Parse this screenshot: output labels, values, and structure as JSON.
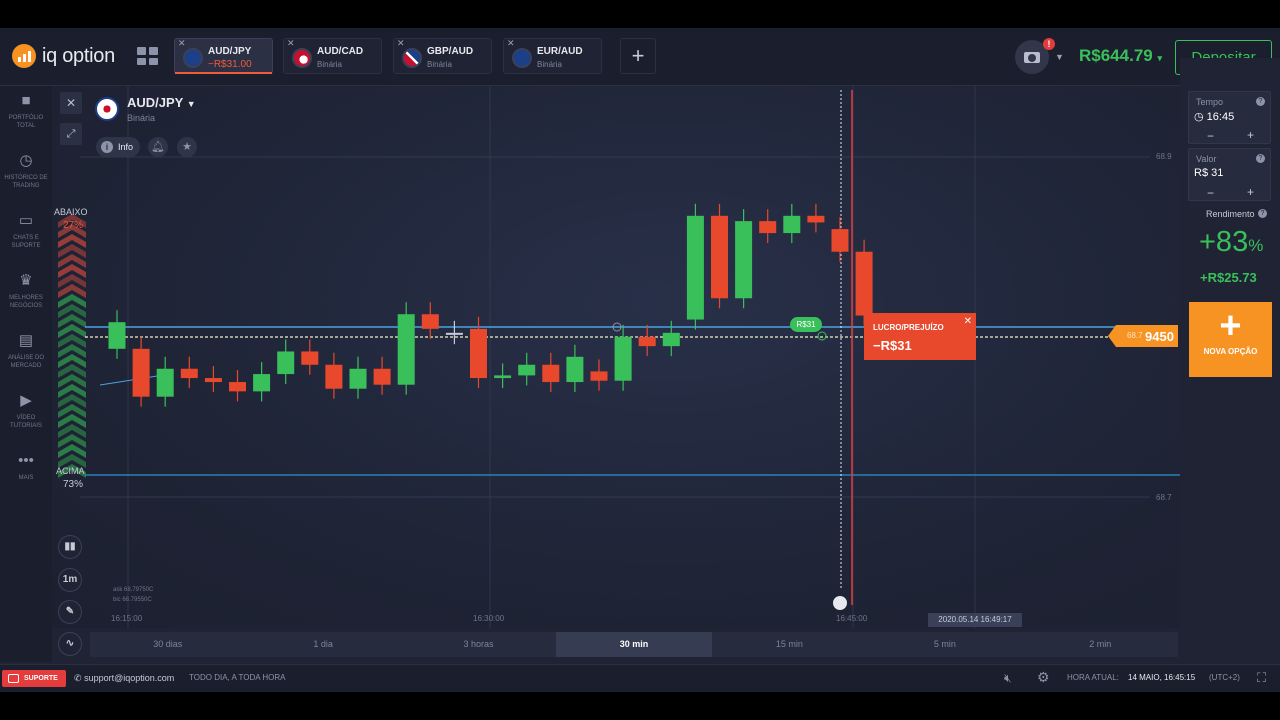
{
  "app": {
    "logo_text": "iq option"
  },
  "tabs": [
    {
      "name": "AUD/JPY",
      "sub": "−R$31.00",
      "active": true
    },
    {
      "name": "AUD/CAD",
      "sub": "Binária"
    },
    {
      "name": "GBP/AUD",
      "sub": "Binária"
    },
    {
      "name": "EUR/AUD",
      "sub": "Binária"
    }
  ],
  "header": {
    "notification_badge": "!",
    "balance": "R$644.79",
    "deposit_label": "Depositar"
  },
  "sidebar": [
    {
      "icon": "briefcase-icon",
      "label": "PORTFÓLIO TOTAL"
    },
    {
      "icon": "history-icon",
      "label": "HISTÓRICO DE TRADING"
    },
    {
      "icon": "chat-icon",
      "label": "CHATS E SUPORTE"
    },
    {
      "icon": "trophy-icon",
      "label": "MELHORES NEGÓCIOS"
    },
    {
      "icon": "analysis-icon",
      "label": "ANÁLISE DO MERCADO"
    },
    {
      "icon": "play-icon",
      "label": "VÍDEO TUTORIAIS"
    },
    {
      "icon": "more-icon",
      "label": "MAIS"
    }
  ],
  "asset": {
    "title": "AUD/JPY",
    "subtitle": "Binária",
    "info_label": "Info"
  },
  "sentiment": {
    "down_label": "ABAIXO",
    "down_pct": "27%",
    "up_label": "ACIMA",
    "up_pct": "73%"
  },
  "trade": {
    "tag": "R$31",
    "profit_label": "LUCRO/PREJUÍZO",
    "profit_value": "−R$31",
    "price_dim": "68.7",
    "price_main": "9450"
  },
  "axis": {
    "y_top": "68.9",
    "y_bottom": "68.7",
    "x_ticks": [
      "16:15:00",
      "16:30:00",
      "16:45:00"
    ],
    "current_time": "2020.05.14 16:49:17",
    "ask": "ask 68.79750C",
    "bid": "bic 68.79550C"
  },
  "tools": {
    "timeframe": "1m"
  },
  "timeframes": [
    {
      "label": "30 dias"
    },
    {
      "label": "1 dia"
    },
    {
      "label": "3 horas"
    },
    {
      "label": "30 min",
      "active": true
    },
    {
      "label": "15 min"
    },
    {
      "label": "5 min"
    },
    {
      "label": "2 min"
    }
  ],
  "right_panel": {
    "time_label": "Tempo",
    "time_value": "16:45",
    "amount_label": "Valor",
    "amount_value": "R$ 31",
    "yield_label": "Rendimento",
    "yield_pct": "+83",
    "yield_value": "+R$25.73",
    "new_option_label": "NOVA OPÇÃO"
  },
  "footer": {
    "support_label": "SUPORTE",
    "email": "support@iqoption.com",
    "hours": "TODO DIA, A TODA HORA",
    "time_label": "HORA ATUAL:",
    "time_value": "14 MAIO, 16:45:15",
    "timezone": "(UTC+2)"
  },
  "chart_data": {
    "type": "candlestick",
    "y_axis_labels": [
      "68.9",
      "68.7"
    ],
    "x_axis_labels": [
      "16:15:00",
      "16:30:00",
      "16:45:00"
    ],
    "candles": [
      {
        "dir": "up",
        "o": 14.0,
        "c": 16.0
      },
      {
        "dir": "down",
        "o": 14.0,
        "c": 10.4
      },
      {
        "dir": "up",
        "o": 10.4,
        "c": 12.5
      },
      {
        "dir": "down",
        "o": 12.5,
        "c": 11.8
      },
      {
        "dir": "down",
        "o": 11.8,
        "c": 11.5
      },
      {
        "dir": "down",
        "o": 11.5,
        "c": 10.8
      },
      {
        "dir": "up",
        "o": 10.8,
        "c": 12.1
      },
      {
        "dir": "up",
        "o": 12.1,
        "c": 13.8
      },
      {
        "dir": "down",
        "o": 13.8,
        "c": 12.8
      },
      {
        "dir": "down",
        "o": 12.8,
        "c": 11.0
      },
      {
        "dir": "up",
        "o": 11.0,
        "c": 12.5
      },
      {
        "dir": "down",
        "o": 12.5,
        "c": 11.3
      },
      {
        "dir": "up",
        "o": 11.3,
        "c": 16.6
      },
      {
        "dir": "down",
        "o": 16.6,
        "c": 15.5
      },
      {
        "dir": "flat",
        "o": 15.2,
        "c": 15.1
      },
      {
        "dir": "down",
        "o": 15.5,
        "c": 11.8
      },
      {
        "dir": "up",
        "o": 11.8,
        "c": 12.0
      },
      {
        "dir": "up",
        "o": 12.0,
        "c": 12.8
      },
      {
        "dir": "down",
        "o": 12.8,
        "c": 11.5
      },
      {
        "dir": "up",
        "o": 11.5,
        "c": 13.4
      },
      {
        "dir": "down",
        "o": 12.3,
        "c": 11.6
      },
      {
        "dir": "up",
        "o": 11.6,
        "c": 14.9
      },
      {
        "dir": "down",
        "o": 14.9,
        "c": 14.2
      },
      {
        "dir": "up",
        "o": 14.2,
        "c": 15.2
      },
      {
        "dir": "up",
        "o": 16.2,
        "c": 24.0
      },
      {
        "dir": "down",
        "o": 24.0,
        "c": 17.8
      },
      {
        "dir": "up",
        "o": 17.8,
        "c": 23.6
      },
      {
        "dir": "down",
        "o": 23.6,
        "c": 22.7
      },
      {
        "dir": "up",
        "o": 22.7,
        "c": 24.0
      },
      {
        "dir": "down",
        "o": 24.0,
        "c": 23.5
      },
      {
        "dir": "down",
        "o": 23.0,
        "c": 21.3
      },
      {
        "dir": "down",
        "o": 21.3,
        "c": 16.5
      }
    ]
  }
}
